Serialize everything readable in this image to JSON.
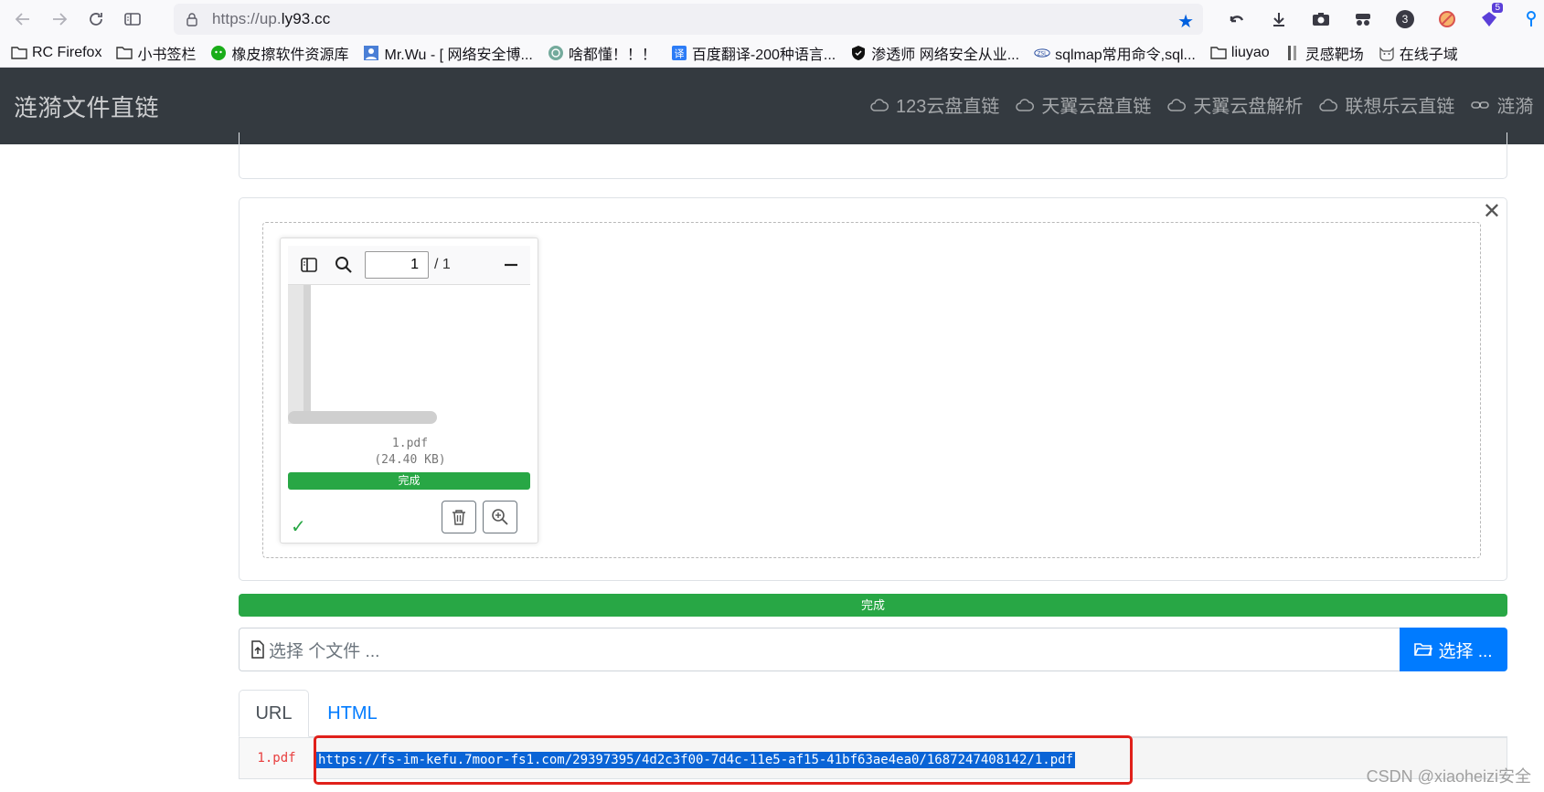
{
  "browser": {
    "url_prefix": "https://up.",
    "url_host": "ly93.cc",
    "extension_badge_count": "3",
    "extension_small_badge": "5"
  },
  "bookmarks": [
    {
      "label": "RC Firefox",
      "icon": "folder-icon"
    },
    {
      "label": "小书签栏",
      "icon": "folder-icon"
    },
    {
      "label": "橡皮擦软件资源库",
      "icon": "wechat-icon"
    },
    {
      "label": "Mr.Wu - [ 网络安全博...",
      "icon": "user-card-icon"
    },
    {
      "label": "啥都懂！！！",
      "icon": "openai-icon"
    },
    {
      "label": "百度翻译-200种语言...",
      "icon": "translate-icon"
    },
    {
      "label": "渗透师 网络安全从业...",
      "icon": "shield-icon"
    },
    {
      "label": "sqlmap常用命令,sql...",
      "icon": "zsl-icon"
    },
    {
      "label": "liuyao",
      "icon": "folder-icon"
    },
    {
      "label": "灵感靶场",
      "icon": "bookmark-icon"
    },
    {
      "label": "在线子域",
      "icon": "cat-icon"
    }
  ],
  "navbar": {
    "brand": "涟漪文件直链",
    "links": [
      {
        "label": "123云盘直链",
        "icon": "cloud-icon"
      },
      {
        "label": "天翼云盘直链",
        "icon": "cloud-icon"
      },
      {
        "label": "天翼云盘解析",
        "icon": "cloud-icon"
      },
      {
        "label": "联想乐云直链",
        "icon": "cloud-icon"
      },
      {
        "label": "涟漪",
        "icon": "link-icon"
      }
    ]
  },
  "preview": {
    "page_current": "1",
    "page_total": "/ 1",
    "file_name": "1.pdf",
    "file_size": "(24.40 KB)",
    "status": "完成",
    "progress": 1.0
  },
  "main_progress": {
    "label": "完成",
    "value": 1.0
  },
  "file_input": {
    "caption": "选择 个文件 ...",
    "browse_label": "选择 ..."
  },
  "tabs": [
    {
      "label": "URL",
      "active": true
    },
    {
      "label": "HTML",
      "active": false
    }
  ],
  "result": {
    "file_label": "1.pdf",
    "url": "https://fs-im-kefu.7moor-fs1.com/29397395/4d2c3f00-7d4c-11e5-af15-41bf63ae4ea0/1687247408142/1.pdf"
  },
  "watermark": "CSDN @xiaoheizi安全",
  "colors": {
    "navbar_bg": "#343a40",
    "success": "#28a745",
    "primary": "#007bff",
    "highlight_border": "#e0201a",
    "selection": "#0a64d6"
  }
}
